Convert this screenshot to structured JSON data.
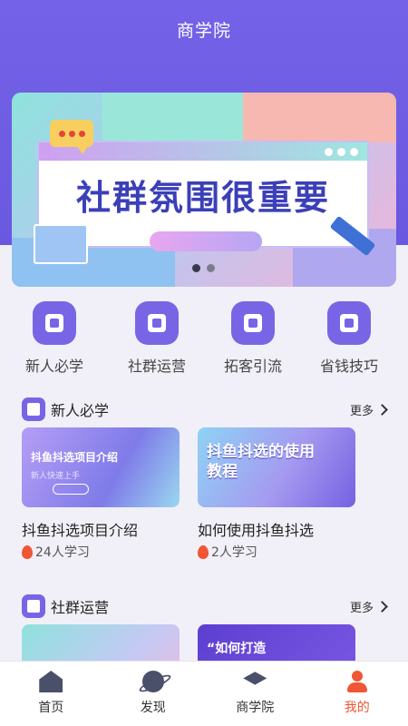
{
  "header": {
    "title": "商学院"
  },
  "banner": {
    "headline": "社群氛围很重要",
    "dots": 2,
    "active_dot": 1
  },
  "quick_links": [
    {
      "label": "新人必学",
      "icon": "book-icon"
    },
    {
      "label": "社群运营",
      "icon": "document-icon"
    },
    {
      "label": "拓客引流",
      "icon": "user-card-icon"
    },
    {
      "label": "省钱技巧",
      "icon": "money-bag-icon"
    }
  ],
  "sections": [
    {
      "title": "新人必学",
      "more_label": "更多",
      "cards": [
        {
          "thumb_text": "抖鱼抖选项目介绍",
          "thumb_sub": "新人快速上手",
          "title": "抖鱼抖选项目介绍",
          "learners": "24人学习"
        },
        {
          "thumb_text": "抖鱼抖选的使用教程",
          "title": "如何使用抖鱼抖选",
          "learners": "2人学习"
        }
      ]
    },
    {
      "title": "社群运营",
      "more_label": "更多",
      "cards": [
        {
          "thumb_text": ""
        },
        {
          "thumb_text": "“如何打造"
        }
      ]
    }
  ],
  "tabbar": [
    {
      "label": "首页",
      "icon": "home-icon"
    },
    {
      "label": "发现",
      "icon": "planet-icon"
    },
    {
      "label": "商学院",
      "icon": "graduation-cap-icon"
    },
    {
      "label": "我的",
      "icon": "user-icon",
      "active": true
    }
  ],
  "colors": {
    "primary": "#7462e8",
    "accent": "#f05535",
    "background": "#f1f0f8"
  }
}
